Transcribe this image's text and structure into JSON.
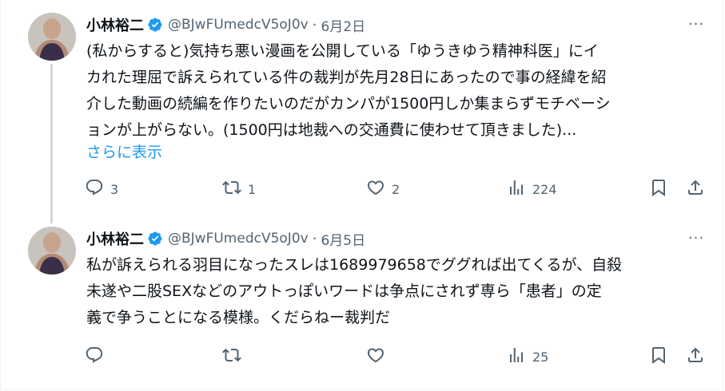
{
  "tweets": [
    {
      "author_name": "小林裕二",
      "handle": "@BJwFUmedcV5oJ0v",
      "separator": "·",
      "date": "6月2日",
      "text": "(私からすると)気持ち悪い漫画を公開している「ゆうきゆう精神科医」にイ\nカれた理屈で訴えられている件の裁判が先月28日にあったので事の経緯を紹\n介した動画の続編を作りたいのだがカンパが1500円しか集まらずモチベーシ\nョンが上がらない。(1500円は地裁への交通費に使わせて頂きました)...",
      "show_more": "さらに表示",
      "replies": "3",
      "retweets": "1",
      "likes": "2",
      "views": "224"
    },
    {
      "author_name": "小林裕二",
      "handle": "@BJwFUmedcV5oJ0v",
      "separator": "·",
      "date": "6月5日",
      "text": "私が訴えられる羽目になったスレは1689979658でググれば出てくるが、自殺\n未遂や二股SEXなどのアウトっぽいワードは争点にされず専ら「患者」の定\n義で争うことになる模様。くだらねー裁判だ",
      "replies": "",
      "retweets": "",
      "likes": "",
      "views": "25"
    }
  ],
  "more_glyph": "···",
  "colors": {
    "accent": "#1d9bf0",
    "secondary_text": "#536471",
    "primary_text": "#0f1419",
    "thread_line": "#cfd9de"
  },
  "icons": [
    "avatar",
    "verified-badge-icon",
    "more-icon",
    "reply-icon",
    "retweet-icon",
    "like-icon",
    "views-icon",
    "bookmark-icon",
    "share-icon"
  ]
}
